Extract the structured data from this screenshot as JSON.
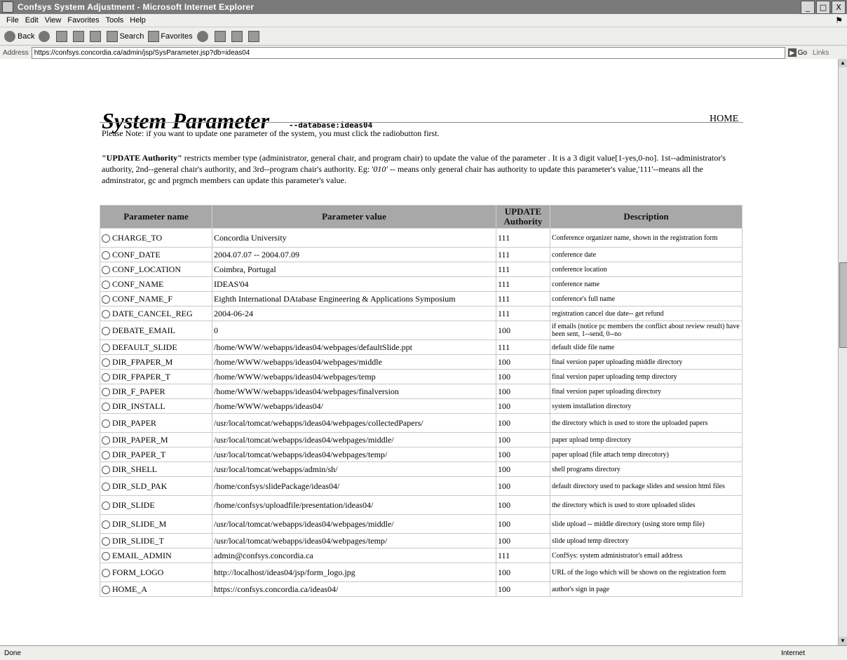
{
  "window": {
    "title": "Confsys System Adjustment - Microsoft Internet Explorer",
    "controls": [
      "_",
      "□",
      "X"
    ]
  },
  "menu": [
    "File",
    "Edit",
    "View",
    "Favorites",
    "Tools",
    "Help"
  ],
  "toolbar": {
    "back": "Back",
    "search": "Search",
    "favorites": "Favorites"
  },
  "address": {
    "label": "Address",
    "url": "https://confsys.concordia.ca/admin/jsp/SysParameter.jsp?db=ideas04",
    "go": "Go",
    "links": "Links"
  },
  "page": {
    "title": "System Parameter",
    "db_label": "--database:ideas04",
    "home_link": "HOME",
    "note1": "Please Note: if you want to update one parameter of the system, you must click the radiobutton first.",
    "note2_bold": "\"UPDATE Authority\"",
    "note2_a": " restricts member type (administrator, general chair, and program chair) to update the value of the parameter . It is a 3 digit value[1-yes,0-no]. 1st--administrator's authority, 2nd--general chair's authority, and 3rd--program chair's authority. Eg: '",
    "note2_example": "010'",
    "note2_b": " -- means only general chair has authority to update this parameter's value,'111'--means all the adminstrator, gc and prgmch members can update this parameter's value."
  },
  "table": {
    "headers": {
      "name": "Parameter name",
      "value": "Parameter value",
      "authority": "UPDATE Authority",
      "description": "Description"
    },
    "rows": [
      {
        "name": "CHARGE_TO",
        "value": "Concordia University",
        "auth": "111",
        "desc": "Conference organizer name, shown in the registration form"
      },
      {
        "name": "CONF_DATE",
        "value": "2004.07.07 -- 2004.07.09",
        "auth": "111",
        "desc": "conference date"
      },
      {
        "name": "CONF_LOCATION",
        "value": "Coimbra, Portugal",
        "auth": "111",
        "desc": "conference location"
      },
      {
        "name": "CONF_NAME",
        "value": "IDEAS'04",
        "auth": "111",
        "desc": "conference name"
      },
      {
        "name": "CONF_NAME_F",
        "value": "Eighth International DAtabase Engineering & Applications Symposium",
        "auth": "111",
        "desc": "conference's full name"
      },
      {
        "name": "DATE_CANCEL_REG",
        "value": "2004-06-24",
        "auth": "111",
        "desc": "registration cancel due date-- get refund"
      },
      {
        "name": "DEBATE_EMAIL",
        "value": "0",
        "auth": "100",
        "desc": "if emails (notice pc members the conflict about review result) have been sent, 1--send, 0--no"
      },
      {
        "name": "DEFAULT_SLIDE",
        "value": "/home/WWW/webapps/ideas04/webpages/defaultSlide.ppt",
        "auth": "111",
        "desc": "default slide file name"
      },
      {
        "name": "DIR_FPAPER_M",
        "value": "/home/WWW/webapps/ideas04/webpages/middle",
        "auth": "100",
        "desc": "final version paper uploading middle directory"
      },
      {
        "name": "DIR_FPAPER_T",
        "value": "/home/WWW/webapps/ideas04/webpages/temp",
        "auth": "100",
        "desc": "final version paper uploading temp directory"
      },
      {
        "name": "DIR_F_PAPER",
        "value": "/home/WWW/webapps/ideas04/webpages/finalversion",
        "auth": "100",
        "desc": "final version paper uploading directory"
      },
      {
        "name": "DIR_INSTALL",
        "value": "/home/WWW/webapps/ideas04/",
        "auth": "100",
        "desc": "system installation directory"
      },
      {
        "name": "DIR_PAPER",
        "value": "/usr/local/tomcat/webapps/ideas04/webpages/collectedPapers/",
        "auth": "100",
        "desc": "the directory which is used to store the uploaded papers"
      },
      {
        "name": "DIR_PAPER_M",
        "value": "/usr/local/tomcat/webapps/ideas04/webpages/middle/",
        "auth": "100",
        "desc": "paper upload temp directory"
      },
      {
        "name": "DIR_PAPER_T",
        "value": "/usr/local/tomcat/webapps/ideas04/webpages/temp/",
        "auth": "100",
        "desc": "paper upload (file attach temp direcotory)"
      },
      {
        "name": "DIR_SHELL",
        "value": "/usr/local/tomcat/webapps/admin/sh/",
        "auth": "100",
        "desc": "shell programs directory"
      },
      {
        "name": "DIR_SLD_PAK",
        "value": "/home/confsys/slidePackage/ideas04/",
        "auth": "100",
        "desc": "default directory used to package slides and session html files"
      },
      {
        "name": "DIR_SLIDE",
        "value": "/home/confsys/uploadfile/presentation/ideas04/",
        "auth": "100",
        "desc": "the directory which is used to store uploaded slides"
      },
      {
        "name": "DIR_SLIDE_M",
        "value": "/usr/local/tomcat/webapps/ideas04/webpages/middle/",
        "auth": "100",
        "desc": "slide upload -- middle directory (using store temp file)"
      },
      {
        "name": "DIR_SLIDE_T",
        "value": "/usr/local/tomcat/webapps/ideas04/webpages/temp/",
        "auth": "100",
        "desc": "slide upload temp directory"
      },
      {
        "name": "EMAIL_ADMIN",
        "value": "admin@confsys.concordia.ca",
        "auth": "111",
        "desc": "ConfSys: system administrator's email address"
      },
      {
        "name": "FORM_LOGO",
        "value": "http://localhost/ideas04/jsp/form_logo.jpg",
        "auth": "100",
        "desc": "URL of the logo which will be shown on the registration form"
      },
      {
        "name": "HOME_A",
        "value": "https://confsys.concordia.ca/ideas04/",
        "auth": "100",
        "desc": "author's sign in page"
      }
    ]
  },
  "status": {
    "text": "Done",
    "zone": "Internet"
  }
}
